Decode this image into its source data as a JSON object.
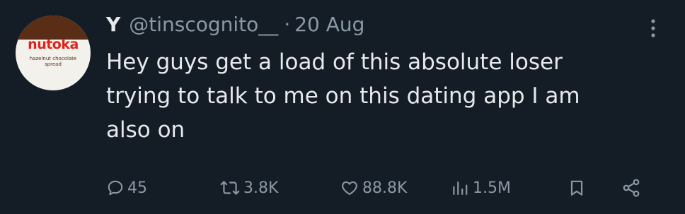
{
  "tweet": {
    "display_name": "Y",
    "handle": "@tinscognito__",
    "separator": "·",
    "date": "20 Aug",
    "text": "Hey guys get a load of this absolute loser\ntrying to talk to me on this dating app I am\nalso on",
    "avatar": {
      "brand": "nutoka",
      "subtitle_line1": "hazelnut chocolate",
      "subtitle_line2": "spread"
    }
  },
  "actions": {
    "replies": "45",
    "retweets": "3.8K",
    "likes": "88.8K",
    "views": "1.5M"
  },
  "icons": {
    "more": "more-vertical-icon",
    "reply": "reply-icon",
    "retweet": "retweet-icon",
    "like": "heart-icon",
    "views": "views-icon",
    "bookmark": "bookmark-icon",
    "share": "share-icon"
  },
  "colors": {
    "background": "#141d26",
    "primary_text": "#e7e9ea",
    "secondary_text": "#8b98a5"
  }
}
